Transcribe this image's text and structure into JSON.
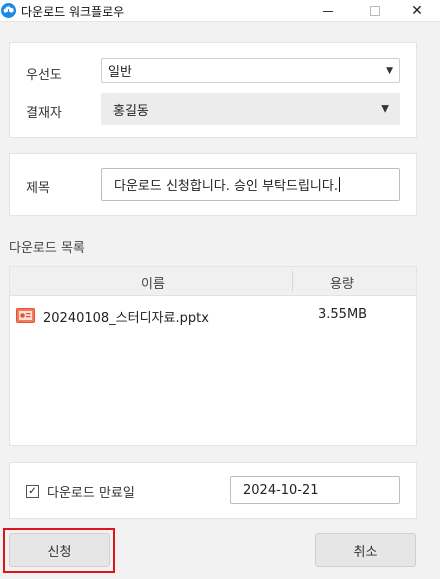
{
  "window": {
    "title": "다운로드 워크플로우",
    "icon": "cloud-download-icon",
    "accent_color": "#1e88e5",
    "minimize_icon": "minimize-icon",
    "maximize_icon": "maximize-icon",
    "close_icon": "close-icon",
    "close_glyph": "✕"
  },
  "form": {
    "priority": {
      "label": "우선도",
      "value": "일반"
    },
    "approver": {
      "label": "결재자",
      "value": "홍길동"
    },
    "subject": {
      "label": "제목",
      "value": "다운로드 신청합니다. 승인 부탁드립니다."
    }
  },
  "download_list": {
    "title": "다운로드 목록",
    "columns": [
      "이름",
      "용량"
    ],
    "rows": [
      {
        "icon": "pptx-file-icon",
        "name": "20240108_스터디자료.pptx",
        "size": "3.55MB"
      }
    ]
  },
  "expiry": {
    "checkbox_checked": true,
    "check_glyph": "✓",
    "label": "다운로드 만료일",
    "date": "2024-10-21"
  },
  "buttons": {
    "apply": "신청",
    "cancel": "취소",
    "highlight_color": "#e0121a"
  }
}
